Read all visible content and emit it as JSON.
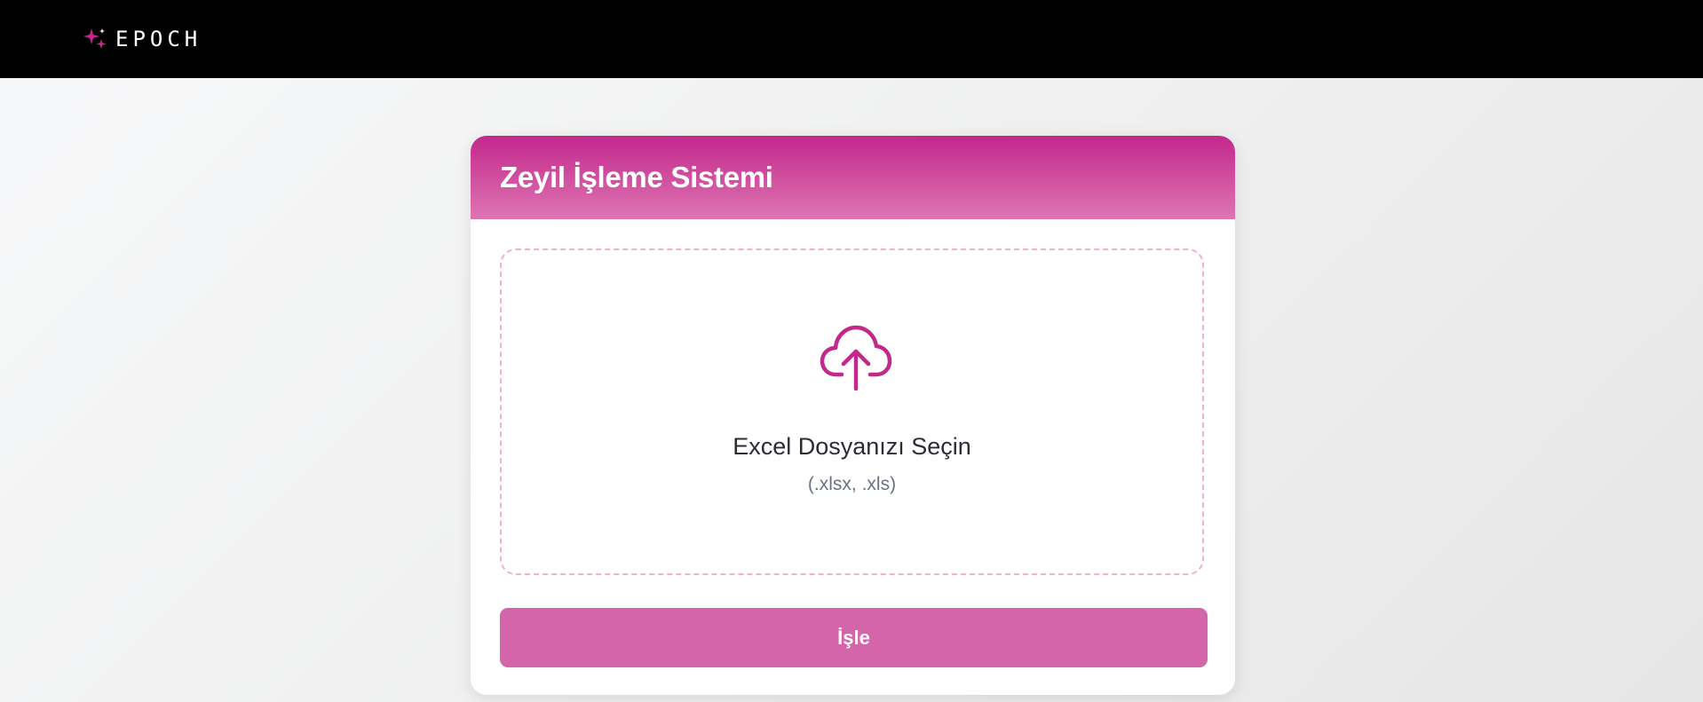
{
  "header": {
    "logo_text": "EPOCH",
    "logo_icon": "sparkle-icon"
  },
  "card": {
    "title": "Zeyil İşleme Sistemi",
    "dropzone": {
      "icon": "cloud-upload-icon",
      "title": "Excel Dosyanızı Seçin",
      "hint": "(.xlsx, .xls)"
    },
    "process_button_label": "İşle"
  },
  "colors": {
    "topbar": "#000000",
    "accent": "#c3288c",
    "accent_light": "#de75b3",
    "button": "#d465ab",
    "dropzone_border": "#efb1cf"
  }
}
